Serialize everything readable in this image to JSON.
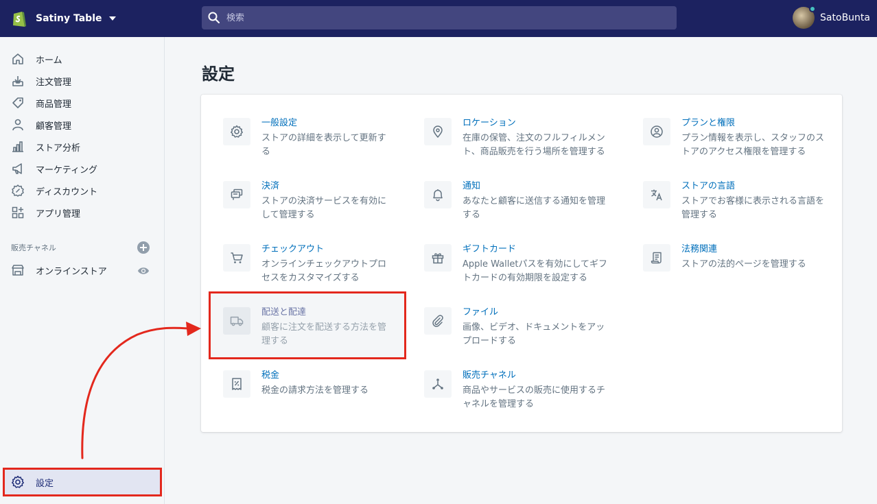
{
  "topbar": {
    "store_name": "Satiny Table",
    "search_placeholder": "検索",
    "user_name": "SatoBunta"
  },
  "sidebar": {
    "items": [
      {
        "label": "ホーム",
        "icon": "home-icon"
      },
      {
        "label": "注文管理",
        "icon": "orders-icon"
      },
      {
        "label": "商品管理",
        "icon": "products-icon"
      },
      {
        "label": "顧客管理",
        "icon": "customers-icon"
      },
      {
        "label": "ストア分析",
        "icon": "analytics-icon"
      },
      {
        "label": "マーケティング",
        "icon": "marketing-icon"
      },
      {
        "label": "ディスカウント",
        "icon": "discount-icon"
      },
      {
        "label": "アプリ管理",
        "icon": "apps-icon"
      }
    ],
    "channels_label": "販売チャネル",
    "online_store": "オンラインストア",
    "settings": "設定"
  },
  "main": {
    "title": "設定",
    "tiles": [
      {
        "title": "一般設定",
        "desc": "ストアの詳細を表示して更新する",
        "icon": "gear-icon"
      },
      {
        "title": "ロケーション",
        "desc": "在庫の保管、注文のフルフィルメント、商品販売を行う場所を管理する",
        "icon": "location-pin-icon"
      },
      {
        "title": "プランと権限",
        "desc": "プラン情報を表示し、スタッフのストアのアクセス権限を管理する",
        "icon": "account-icon"
      },
      {
        "title": "決済",
        "desc": "ストアの決済サービスを有効にして管理する",
        "icon": "payments-icon"
      },
      {
        "title": "通知",
        "desc": "あなたと顧客に送信する通知を管理する",
        "icon": "bell-icon"
      },
      {
        "title": "ストアの言語",
        "desc": "ストアでお客様に表示される言語を管理する",
        "icon": "translate-icon"
      },
      {
        "title": "チェックアウト",
        "desc": "オンラインチェックアウトプロセスをカスタマイズする",
        "icon": "cart-icon"
      },
      {
        "title": "ギフトカード",
        "desc": "Apple Walletパスを有効にしてギフトカードの有効期限を設定する",
        "icon": "gift-icon"
      },
      {
        "title": "法務関連",
        "desc": "ストアの法的ページを管理する",
        "icon": "legal-icon"
      },
      {
        "title": "配送と配達",
        "desc": "顧客に注文を配送する方法を管理する",
        "icon": "truck-icon"
      },
      {
        "title": "ファイル",
        "desc": "画像、ビデオ、ドキュメントをアップロードする",
        "icon": "paperclip-icon"
      },
      {
        "title": "税金",
        "desc": "税金の請求方法を管理する",
        "icon": "tax-icon"
      },
      {
        "title": "販売チャネル",
        "desc": "商品やサービスの販売に使用するチャネルを管理する",
        "icon": "channels-icon"
      }
    ]
  },
  "colors": {
    "topbar": "#1c2260",
    "link": "#006fbb",
    "highlight": "#e3281d"
  }
}
